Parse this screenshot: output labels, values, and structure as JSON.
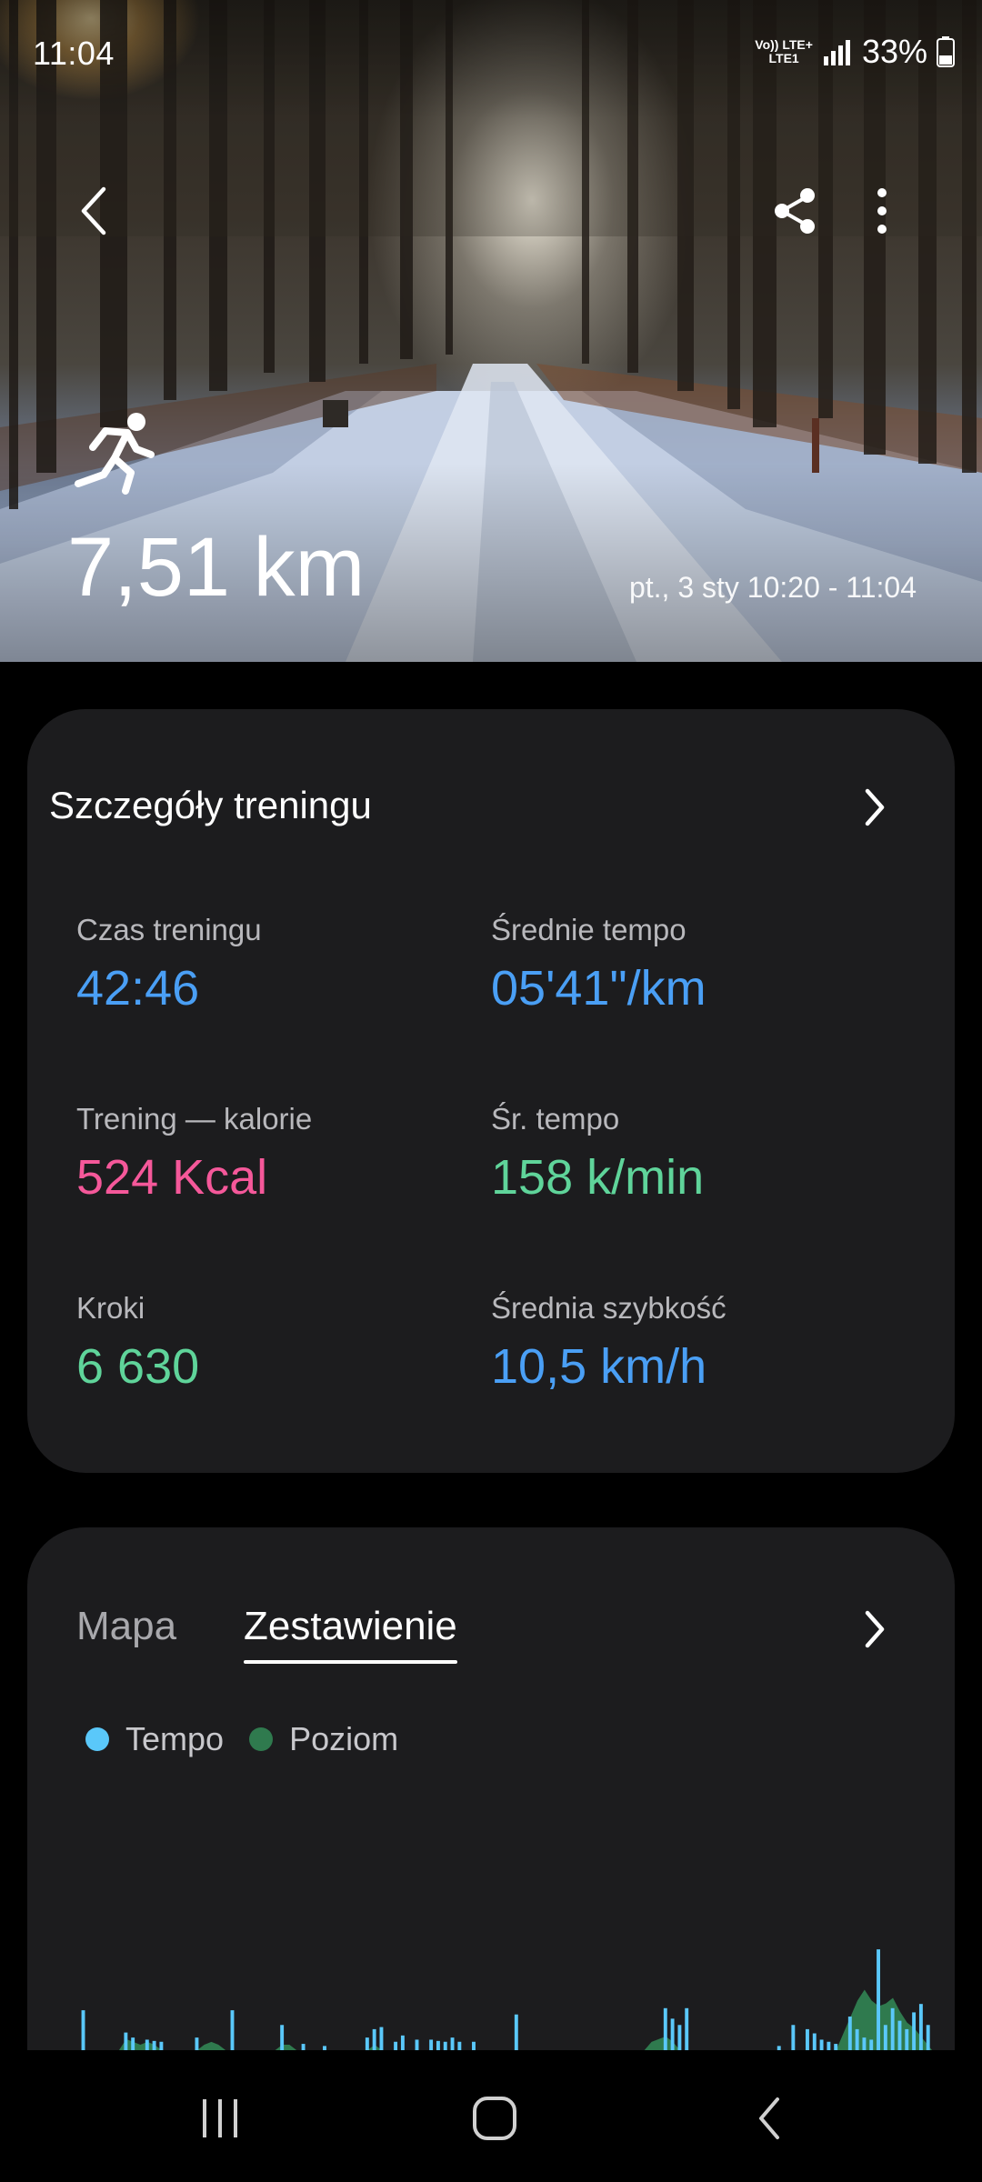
{
  "status_bar": {
    "time": "11:04",
    "network_top": "Vo)) LTE+",
    "network_bottom": "LTE1",
    "battery": "33%"
  },
  "hero": {
    "activity_icon": "running-person-icon",
    "distance": "7,51 km",
    "date_range": "pt., 3 sty 10:20 - 11:04"
  },
  "details_card": {
    "title": "Szczegóły treningu",
    "metrics": [
      {
        "label": "Czas treningu",
        "value": "42:46",
        "color": "#4a9ff5"
      },
      {
        "label": "Średnie tempo",
        "value": "05'41\"/km",
        "color": "#4a9ff5"
      },
      {
        "label": "Trening — kalorie",
        "value": "524 Kcal",
        "color": "#f5589a"
      },
      {
        "label": "Śr. tempo",
        "value": "158 k/min",
        "color": "#5fd49a"
      },
      {
        "label": "Kroki",
        "value": "6 630",
        "color": "#5fd49a"
      },
      {
        "label": "Średnia szybkość",
        "value": "10,5 km/h",
        "color": "#4a9ff5"
      }
    ]
  },
  "summary_card": {
    "tabs": [
      {
        "label": "Mapa",
        "selected": false
      },
      {
        "label": "Zestawienie",
        "selected": true
      }
    ],
    "legend": [
      {
        "label": "Tempo",
        "color": "#5ac8fa"
      },
      {
        "label": "Poziom",
        "color": "#2f7a4e"
      }
    ]
  },
  "chart_data": {
    "type": "bar",
    "series": [
      {
        "name": "Tempo",
        "color": "#5ac8fa",
        "values": [
          0.95,
          0,
          0,
          0,
          0,
          0,
          0.42,
          0.3,
          0,
          0.25,
          0.22,
          0.2,
          0,
          0,
          0,
          0,
          0.3,
          0,
          0,
          0,
          0,
          0.95,
          0,
          0,
          0,
          0,
          0,
          0,
          0.6,
          0,
          0,
          0.15,
          0,
          0,
          0.1,
          0,
          0,
          0,
          0,
          0,
          0.3,
          0.5,
          0.55,
          0,
          0.2,
          0.35,
          0,
          0.25,
          0,
          0.25,
          0.22,
          0.2,
          0.3,
          0.2,
          0,
          0.2,
          0,
          0,
          0,
          0,
          0,
          0.85,
          0,
          0,
          0,
          0,
          0,
          0,
          0,
          0,
          0,
          0,
          0,
          0,
          0,
          0,
          0,
          0,
          0,
          0,
          0,
          0,
          1.0,
          0.75,
          0.6,
          1.0,
          0,
          0,
          0,
          0,
          0,
          0,
          0,
          0,
          0,
          0,
          0,
          0,
          0.1,
          0,
          0.6,
          0,
          0.5,
          0.4,
          0.25,
          0.2,
          0.15,
          0,
          0.8,
          0.5,
          0.3,
          0.25,
          2.4,
          0.6,
          1.0,
          0.7,
          0.5,
          0.9,
          1.1,
          0.6
        ]
      },
      {
        "name": "Poziom",
        "color": "#2f7a4e",
        "values": [
          0,
          0,
          0,
          0,
          0,
          0,
          0.2,
          0.15,
          0.1,
          0.15,
          0.1,
          0,
          0,
          0,
          0,
          0,
          0,
          0.1,
          0.15,
          0.1,
          0,
          0,
          0,
          0,
          0,
          0,
          0,
          0,
          0.1,
          0.1,
          0,
          0,
          0,
          0,
          0,
          0,
          0,
          0,
          0,
          0,
          0,
          0.1,
          0,
          0,
          0,
          0,
          0,
          0,
          0,
          0,
          0,
          0,
          0,
          0,
          0,
          0,
          0,
          0,
          0,
          0,
          0,
          0,
          0,
          0,
          0,
          0,
          0,
          0,
          0,
          0,
          0,
          0,
          0,
          0,
          0,
          0,
          0,
          0,
          0,
          0,
          0.15,
          0.2,
          0.25,
          0.15,
          0,
          0,
          0,
          0,
          0,
          0,
          0,
          0,
          0,
          0,
          0,
          0,
          0,
          0,
          0,
          0,
          0,
          0,
          0,
          0,
          0,
          0,
          0,
          0.3,
          0.6,
          0.9,
          1.1,
          0.9,
          0.8,
          0.85,
          0.95,
          0.7,
          0.5,
          0.4
        ]
      }
    ],
    "legend_position": "top-left",
    "grid": false
  },
  "nav_bar": {
    "recents": "recents-icon",
    "home": "home-icon",
    "back": "back-icon"
  }
}
